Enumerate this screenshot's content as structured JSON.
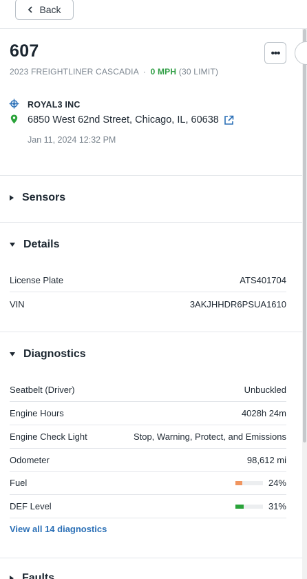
{
  "topbar": {
    "back_label": "Back"
  },
  "vehicle": {
    "name": "607",
    "model": "2023 FREIGHTLINER CASCADIA",
    "separator": "·",
    "speed": "0 MPH",
    "limit": "(30 LIMIT)"
  },
  "location": {
    "company": "ROYAL3 INC",
    "address": "6850 West 62nd Street, Chicago, IL, 60638",
    "timestamp": "Jan 11, 2024 12:32 PM"
  },
  "sections": {
    "sensors": "Sensors",
    "details": "Details",
    "diagnostics": "Diagnostics",
    "faults": "Faults"
  },
  "details": {
    "rows": [
      {
        "label": "License Plate",
        "value": "ATS401704"
      },
      {
        "label": "VIN",
        "value": "3AKJHHDR6PSUA1610"
      }
    ]
  },
  "diagnostics": {
    "rows": [
      {
        "label": "Seatbelt (Driver)",
        "value": "Unbuckled"
      },
      {
        "label": "Engine Hours",
        "value": "4028h 24m"
      },
      {
        "label": "Engine Check Light",
        "value": "Stop, Warning, Protect, and Emissions"
      },
      {
        "label": "Odometer",
        "value": "98,612 mi"
      },
      {
        "label": "Fuel",
        "value": "24%",
        "level": 0.24,
        "color": "#f0955f"
      },
      {
        "label": "DEF Level",
        "value": "31%",
        "level": 0.31,
        "color": "#2aa33a"
      }
    ],
    "view_all": "View all 14 diagnostics"
  },
  "colors": {
    "accent_link": "#2a6fb6",
    "speed_green": "#2f9e44",
    "location_pin": "#2aa33a",
    "company_icon": "#2a6fb6"
  },
  "icons": {
    "back": "chevron-left-icon",
    "more": "more-horizontal-icon",
    "company": "crosshair-icon",
    "location": "map-pin-icon",
    "external": "external-link-icon",
    "collapsed": "caret-right-icon",
    "expanded": "caret-down-icon"
  }
}
